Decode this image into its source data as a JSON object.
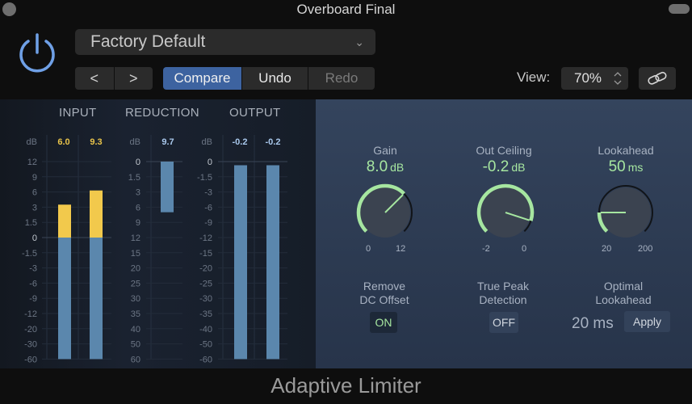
{
  "window": {
    "title": "Overboard Final"
  },
  "header": {
    "preset": "Factory Default",
    "prev_label": "<",
    "next_label": ">",
    "compare_label": "Compare",
    "undo_label": "Undo",
    "redo_label": "Redo",
    "view_label": "View:",
    "view_value": "70%"
  },
  "meters": {
    "input": {
      "title": "INPUT",
      "db_label": "dB",
      "peaks": [
        "6.0",
        "9.3"
      ],
      "scale": [
        "12",
        "9",
        "6",
        "3",
        "1.5",
        "0",
        "-1.5",
        "-3",
        "-6",
        "-9",
        "-12",
        "-20",
        "-30",
        "-60"
      ],
      "levels_db": [
        3.5,
        6.3
      ],
      "colors": {
        "over": "#f2c94c",
        "under": "#5b87ad"
      }
    },
    "reduction": {
      "title": "REDUCTION",
      "db_label": "dB",
      "peaks": [
        "9.7"
      ],
      "scale": [
        "0",
        "1.5",
        "3",
        "6",
        "9",
        "12",
        "15",
        "20",
        "25",
        "30",
        "35",
        "40",
        "50",
        "60"
      ],
      "levels_db": [
        7.0
      ],
      "colors": {
        "bar": "#5b87ad"
      }
    },
    "output": {
      "title": "OUTPUT",
      "db_label": "dB",
      "peaks": [
        "-0.2",
        "-0.2"
      ],
      "scale": [
        "0",
        "-1.5",
        "-3",
        "-6",
        "-9",
        "-12",
        "-15",
        "-20",
        "-25",
        "-30",
        "-35",
        "-40",
        "-50",
        "-60"
      ],
      "levels_db": [
        -0.2,
        -0.2
      ],
      "colors": {
        "bar": "#5b87ad"
      }
    }
  },
  "controls": {
    "gain": {
      "label": "Gain",
      "value": "8.0",
      "unit": "dB",
      "min": "0",
      "max": "12",
      "fraction": 0.667
    },
    "out_ceiling": {
      "label": "Out Ceiling",
      "value": "-0.2",
      "unit": "dB",
      "min": "-2",
      "max": "0",
      "fraction": 0.9
    },
    "lookahead": {
      "label": "Lookahead",
      "value": "50",
      "unit": "ms",
      "min": "20",
      "max": "200",
      "fraction": 0.167
    },
    "remove_dc": {
      "label_line1": "Remove",
      "label_line2": "DC Offset",
      "state": "ON"
    },
    "true_peak": {
      "label_line1": "True Peak",
      "label_line2": "Detection",
      "state": "OFF"
    },
    "optimal_lookahead": {
      "label_line1": "Optimal",
      "label_line2": "Lookahead",
      "value": "20 ms",
      "apply_label": "Apply"
    },
    "accent": "#a6e6a0"
  },
  "footer": {
    "plugin_name": "Adaptive Limiter"
  }
}
